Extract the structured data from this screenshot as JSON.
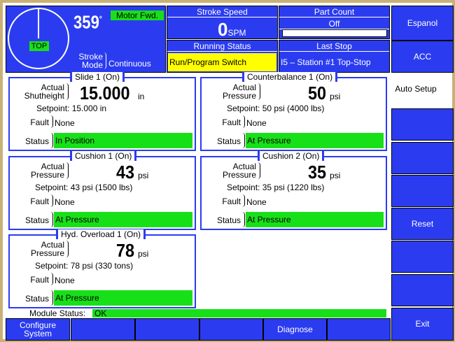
{
  "header": {
    "angle_value": "359",
    "angle_unit": "°",
    "motor_status": "Motor Fwd.",
    "top_label": "TOP",
    "stroke_mode_label": "Stroke\nMode",
    "stroke_mode_value": "Continuous",
    "stroke_speed_title": "Stroke Speed",
    "stroke_speed_value": "0",
    "stroke_speed_unit": "SPM",
    "part_count_title": "Part Count",
    "part_count_status": "Off",
    "part_count_value": "",
    "running_status_title": "Running Status",
    "running_status_value": "Run/Program Switch",
    "last_stop_title": "Last Stop",
    "last_stop_value": "I5 – Station #1 Top-Stop"
  },
  "side_buttons": [
    "Espanol",
    "ACC",
    "Auto Setup",
    "",
    "",
    "",
    "Reset",
    "",
    "",
    "Exit"
  ],
  "bottom_buttons": [
    "Configure System",
    "",
    "",
    "",
    "Diagnose",
    ""
  ],
  "labels": {
    "actual_shutheight": "Actual\nShutheight",
    "actual_pressure": "Actual\nPressure",
    "fault": "Fault",
    "status": "Status"
  },
  "panels": {
    "slide1": {
      "title": "Slide 1 (On)",
      "value": "15.000",
      "unit": "in",
      "setpoint": "Setpoint:  15.000 in",
      "fault": "None",
      "status": "In Position"
    },
    "counterbalance1": {
      "title": "Counterbalance 1 (On)",
      "value": "50",
      "unit": "psi",
      "setpoint": "Setpoint:  50 psi  (4000 lbs)",
      "fault": "None",
      "status": "At Pressure"
    },
    "cushion1": {
      "title": "Cushion 1 (On)",
      "value": "43",
      "unit": "psi",
      "setpoint": "Setpoint:  43 psi  (1500 lbs)",
      "fault": "None",
      "status": "At Pressure"
    },
    "cushion2": {
      "title": "Cushion 2 (On)",
      "value": "35",
      "unit": "psi",
      "setpoint": "Setpoint:  35 psi  (1220 lbs)",
      "fault": "None",
      "status": "At Pressure"
    },
    "hydoverload1": {
      "title": "Hyd. Overload 1 (On)",
      "value": "78",
      "unit": "psi",
      "setpoint": "Setpoint:  78 psi  (330 tons)",
      "fault": "None",
      "status": "At Pressure"
    }
  },
  "module_status": {
    "label": "Module Status:",
    "value": "OK"
  },
  "colors": {
    "blue": "#2b3cf0",
    "green": "#18e018",
    "yellow": "#ffff00",
    "frame": "#c8b078"
  }
}
